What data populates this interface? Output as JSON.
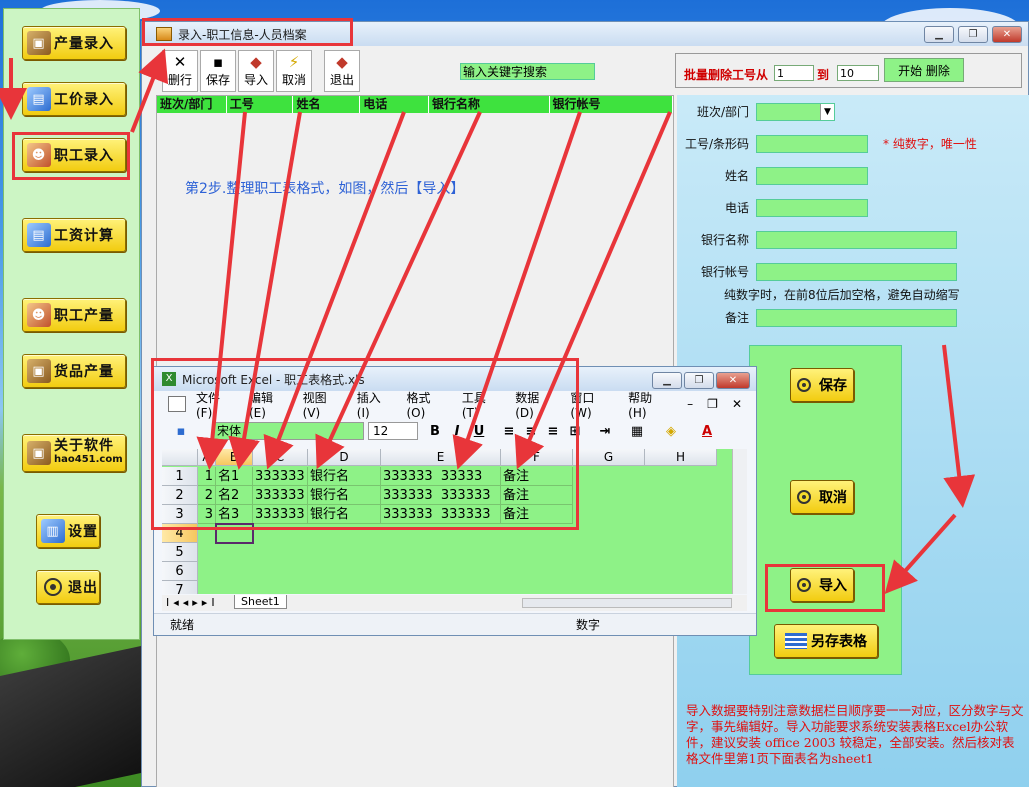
{
  "colors": {
    "accent_green": "#8ef287",
    "header_green": "#3ee23e",
    "button_yellow": "#f2cc10",
    "annotation_red": "#e8353a",
    "note_red": "#e01010",
    "step_blue": "#2e62d6"
  },
  "sidebar": {
    "items": [
      {
        "label": "产量录入",
        "icon": "box-icon"
      },
      {
        "label": "工价录入",
        "icon": "chart-icon"
      },
      {
        "label": "职工录入",
        "icon": "people-icon"
      },
      {
        "label": "工资计算",
        "icon": "chart-icon"
      },
      {
        "label": "职工产量",
        "icon": "people-icon"
      },
      {
        "label": "货品产量",
        "icon": "box-icon"
      },
      {
        "label": "关于软件",
        "sub": "hao451.com",
        "icon": "box-icon"
      },
      {
        "label": "设置",
        "icon": "book-icon"
      },
      {
        "label": "退出",
        "icon": "exit-icon"
      }
    ]
  },
  "main_window": {
    "title": "录入-职工信息-人员档案",
    "toolbar": [
      {
        "label": "删行",
        "icon": "x-icon"
      },
      {
        "label": "保存",
        "icon": "save-icon"
      },
      {
        "label": "导入",
        "icon": "import-icon"
      },
      {
        "label": "取消",
        "icon": "cancel-icon"
      },
      {
        "label": "退出",
        "icon": "exit-icon"
      }
    ],
    "search_value": "输入关键字搜索",
    "batch_delete": {
      "label_from": "批量删除工号从",
      "label_to": "到",
      "from_value": "1",
      "to_value": "10",
      "button": "开始 删除"
    },
    "grid_columns": [
      "班次/部门",
      "工号",
      "姓名",
      "电话",
      "银行名称",
      "银行帐号"
    ],
    "step_text": "第2步.整理职工表格式，如图，然后【导入】"
  },
  "form": {
    "fields": [
      {
        "label": "班次/部门"
      },
      {
        "label": "工号/条形码",
        "hint": "* 纯数字，唯一性"
      },
      {
        "label": "姓名"
      },
      {
        "label": "电话"
      },
      {
        "label": "银行名称"
      },
      {
        "label": "银行帐号"
      },
      {
        "label": "备注"
      }
    ],
    "account_hint": "纯数字时，在前8位后加空格，避免自动缩写",
    "buttons": {
      "save": "保存",
      "cancel": "取消",
      "import": "导入",
      "saveas": "另存表格"
    },
    "note": "导入数据要特别注意数据栏目顺序要一一对应，区分数字与文字，事先编辑好。导入功能要求系统安装表格Excel办公软件，建议安装 office 2003 较稳定，全部安装。然后核对表格文件里第1页下面表名为sheet1"
  },
  "excel": {
    "title": "Microsoft Excel - 职工表格式.xls",
    "menu": [
      "文件(F)",
      "编辑(E)",
      "视图(V)",
      "插入(I)",
      "格式(O)",
      "工具(T)",
      "数据(D)",
      "窗口(W)",
      "帮助(H)"
    ],
    "font_name": "宋体",
    "font_size": "12",
    "columns": [
      "A",
      "B",
      "C",
      "D",
      "E",
      "F",
      "G",
      "H"
    ],
    "row_numbers": [
      "1",
      "2",
      "3",
      "4",
      "5",
      "6",
      "7"
    ],
    "rows": [
      [
        "1",
        "名1",
        "333333",
        "银行名",
        "333333  33333",
        "备注"
      ],
      [
        "2",
        "名2",
        "333333",
        "银行名",
        "333333  333333",
        "备注"
      ],
      [
        "3",
        "名3",
        "333333",
        "银行名",
        "333333  333333",
        "备注"
      ]
    ],
    "sheet_tab": "Sheet1",
    "status": "就绪",
    "status_right": "数字"
  }
}
